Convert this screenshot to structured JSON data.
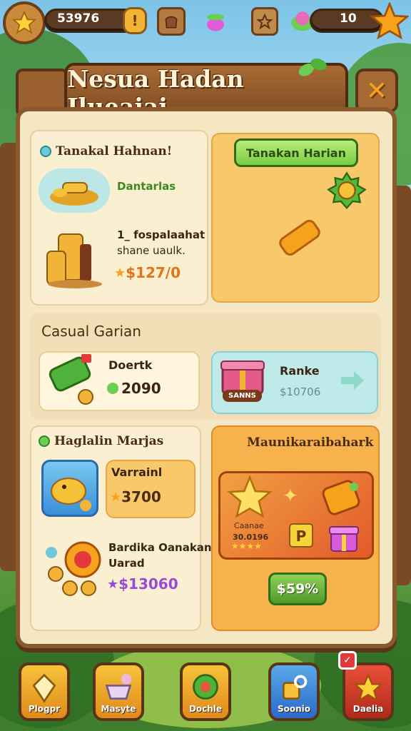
{
  "topbar": {
    "coins": "53976",
    "energy": "10"
  },
  "window": {
    "title": "Nesua Hadan Ilueaiai",
    "close_label": "✕"
  },
  "daily": {
    "title": "Tanakal Hahnan!",
    "item1_label": "Dantarlas",
    "item2_label_line1": "1_ fospalaahat",
    "item2_label_line2": "shane uaulk.",
    "item2_price": "$127/0",
    "claim_button": "Tanakan Harian"
  },
  "casual": {
    "title": "Casual Garian",
    "item1_name": "Doertk",
    "item1_price": "2090",
    "item2_name": "Ranke",
    "item2_price": "$10706",
    "item2_badge": "SANNS"
  },
  "bundles": {
    "title": "Haglalin Marjas",
    "pet_name": "Varrainl",
    "pet_price": "3700",
    "coin_title_line1": "Bardika Oanakan",
    "coin_title_line2": "Uarad",
    "coin_price": "$13060",
    "special_title": "Maunikaraibahark",
    "special_card_label": "Caanae",
    "special_card_sub": "30.0196",
    "special_button": "$59%"
  },
  "nav": {
    "items": [
      {
        "label": "Plogpr"
      },
      {
        "label": "Masyte"
      },
      {
        "label": "Dochle"
      },
      {
        "label": "Soonio"
      },
      {
        "label": "Daelia"
      }
    ]
  },
  "colors": {
    "wood": "#8a5a2e",
    "cream": "#f6e7c4",
    "orange": "#f7a21b",
    "green": "#4e9a2a"
  }
}
